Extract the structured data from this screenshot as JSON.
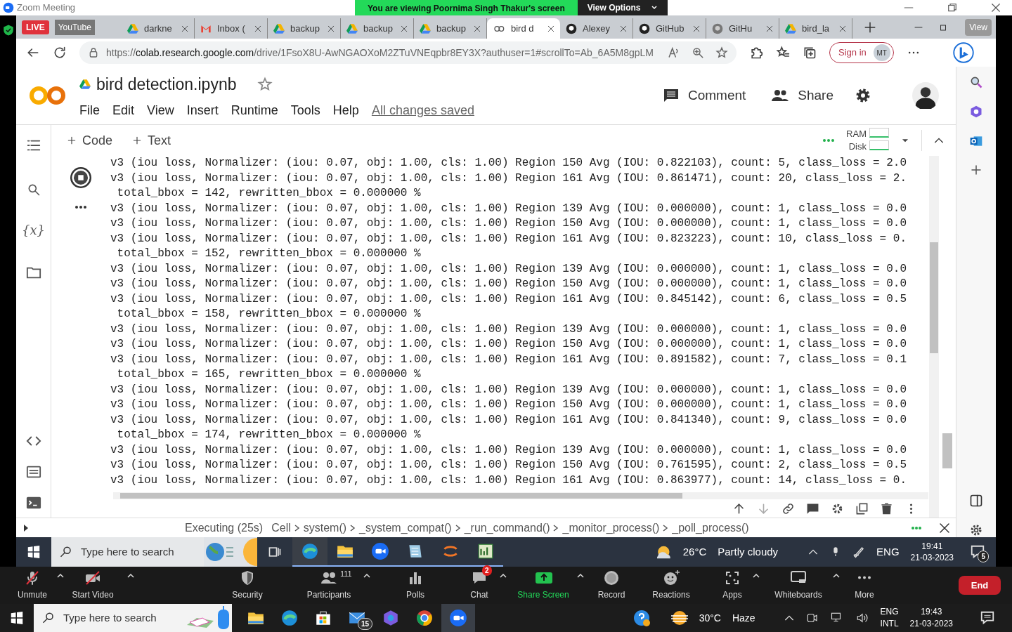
{
  "zoom_window": {
    "title": "Zoom Meeting",
    "banner": "You are viewing Poornima Singh Thakur's screen",
    "view_options": "View Options"
  },
  "stream_overlay": {
    "live": "LIVE",
    "platform": "YouTube",
    "view": "View"
  },
  "browser": {
    "tabs": [
      {
        "label": "darkne",
        "kind": "drive",
        "selected": false
      },
      {
        "label": "Inbox (",
        "kind": "gmail",
        "selected": false
      },
      {
        "label": "backup",
        "kind": "drive",
        "selected": false
      },
      {
        "label": "backup",
        "kind": "drive",
        "selected": false
      },
      {
        "label": "backup",
        "kind": "drive",
        "selected": false
      },
      {
        "label": "bird d",
        "kind": "colab",
        "selected": true
      },
      {
        "label": "Alexey",
        "kind": "github",
        "selected": false
      },
      {
        "label": "GitHub",
        "kind": "github",
        "selected": false
      },
      {
        "label": "GitHu",
        "kind": "github-grey",
        "selected": false
      },
      {
        "label": "bird_la",
        "kind": "drive",
        "selected": false
      }
    ],
    "url": {
      "scheme": "https://",
      "host": "colab.research.google.com",
      "path": "/drive/1FsoX8U-AwNGAOXoM2ZTuVNEqpbr8EY3X?authuser=1#scrollTo=Ab_6A5M8gpLM"
    },
    "sign_in": "Sign in",
    "profile": "MT"
  },
  "colab": {
    "title": "bird detection.ipynb",
    "menu": [
      "File",
      "Edit",
      "View",
      "Insert",
      "Runtime",
      "Tools",
      "Help"
    ],
    "saved": "All changes saved",
    "comment": "Comment",
    "share": "Share",
    "add_buttons": [
      "Code",
      "Text"
    ],
    "ram": "RAM",
    "disk": "Disk",
    "variables": "{x}",
    "output": [
      "v3 (iou loss, Normalizer: (iou: 0.07, obj: 1.00, cls: 1.00) Region 150 Avg (IOU: 0.822103), count: 5, class_loss = 2.0",
      "v3 (iou loss, Normalizer: (iou: 0.07, obj: 1.00, cls: 1.00) Region 161 Avg (IOU: 0.861471), count: 20, class_loss = 2.",
      " total_bbox = 142, rewritten_bbox = 0.000000 %",
      "v3 (iou loss, Normalizer: (iou: 0.07, obj: 1.00, cls: 1.00) Region 139 Avg (IOU: 0.000000), count: 1, class_loss = 0.0",
      "v3 (iou loss, Normalizer: (iou: 0.07, obj: 1.00, cls: 1.00) Region 150 Avg (IOU: 0.000000), count: 1, class_loss = 0.0",
      "v3 (iou loss, Normalizer: (iou: 0.07, obj: 1.00, cls: 1.00) Region 161 Avg (IOU: 0.823223), count: 10, class_loss = 0.",
      " total_bbox = 152, rewritten_bbox = 0.000000 %",
      "v3 (iou loss, Normalizer: (iou: 0.07, obj: 1.00, cls: 1.00) Region 139 Avg (IOU: 0.000000), count: 1, class_loss = 0.0",
      "v3 (iou loss, Normalizer: (iou: 0.07, obj: 1.00, cls: 1.00) Region 150 Avg (IOU: 0.000000), count: 1, class_loss = 0.0",
      "v3 (iou loss, Normalizer: (iou: 0.07, obj: 1.00, cls: 1.00) Region 161 Avg (IOU: 0.845142), count: 6, class_loss = 0.5",
      " total_bbox = 158, rewritten_bbox = 0.000000 %",
      "v3 (iou loss, Normalizer: (iou: 0.07, obj: 1.00, cls: 1.00) Region 139 Avg (IOU: 0.000000), count: 1, class_loss = 0.0",
      "v3 (iou loss, Normalizer: (iou: 0.07, obj: 1.00, cls: 1.00) Region 150 Avg (IOU: 0.000000), count: 1, class_loss = 0.0",
      "v3 (iou loss, Normalizer: (iou: 0.07, obj: 1.00, cls: 1.00) Region 161 Avg (IOU: 0.891582), count: 7, class_loss = 0.1",
      " total_bbox = 165, rewritten_bbox = 0.000000 %",
      "v3 (iou loss, Normalizer: (iou: 0.07, obj: 1.00, cls: 1.00) Region 139 Avg (IOU: 0.000000), count: 1, class_loss = 0.0",
      "v3 (iou loss, Normalizer: (iou: 0.07, obj: 1.00, cls: 1.00) Region 150 Avg (IOU: 0.000000), count: 1, class_loss = 0.0",
      "v3 (iou loss, Normalizer: (iou: 0.07, obj: 1.00, cls: 1.00) Region 161 Avg (IOU: 0.841340), count: 9, class_loss = 0.0",
      " total_bbox = 174, rewritten_bbox = 0.000000 %",
      "v3 (iou loss, Normalizer: (iou: 0.07, obj: 1.00, cls: 1.00) Region 139 Avg (IOU: 0.000000), count: 1, class_loss = 0.0",
      "v3 (iou loss, Normalizer: (iou: 0.07, obj: 1.00, cls: 1.00) Region 150 Avg (IOU: 0.761595), count: 2, class_loss = 0.5",
      "v3 (iou loss, Normalizer: (iou: 0.07, obj: 1.00, cls: 1.00) Region 161 Avg (IOU: 0.863977), count: 14, class_loss = 0."
    ],
    "status": {
      "state": "Executing (25s)",
      "trace": [
        "Cell",
        "system()",
        "_system_compat()",
        "_run_command()",
        "_monitor_process()",
        "_poll_process()"
      ]
    }
  },
  "inner_taskbar": {
    "search": "Type here to search",
    "apps": [
      {
        "kind": "edge",
        "active": true
      },
      {
        "kind": "folder",
        "active": false
      },
      {
        "kind": "zoom",
        "active": false
      },
      {
        "kind": "notepad",
        "active": false
      },
      {
        "kind": "jupyter",
        "active": false
      },
      {
        "kind": "sheet",
        "active": false
      }
    ],
    "temperature": "26°C",
    "weather": "Partly cloudy",
    "language": "ENG",
    "time": "19:41",
    "date": "21-03-2023",
    "notifications": "5"
  },
  "zoom_controls": [
    {
      "label": "Unmute",
      "kind": "mic-off",
      "caret": true
    },
    {
      "label": "Start Video",
      "kind": "video-off",
      "caret": true
    },
    {
      "label": "Security",
      "kind": "shield",
      "caret": false
    },
    {
      "label": "Participants",
      "kind": "people",
      "caret": true,
      "count": "111"
    },
    {
      "label": "Polls",
      "kind": "polls",
      "caret": false
    },
    {
      "label": "Chat",
      "kind": "chat",
      "caret": true,
      "badge": "2"
    },
    {
      "label": "Share Screen",
      "kind": "share",
      "caret": true
    },
    {
      "label": "Record",
      "kind": "record",
      "caret": false
    },
    {
      "label": "Reactions",
      "kind": "reactions",
      "caret": false
    },
    {
      "label": "Apps",
      "kind": "apps",
      "caret": true
    },
    {
      "label": "Whiteboards",
      "kind": "whiteboard",
      "caret": true
    },
    {
      "label": "More",
      "kind": "more",
      "caret": false
    }
  ],
  "end_button": "End",
  "taskbar": {
    "search": "Type here to search",
    "apps": [
      {
        "kind": "folder",
        "active": false
      },
      {
        "kind": "edge",
        "active": false
      },
      {
        "kind": "store",
        "active": false
      },
      {
        "kind": "mail",
        "active": false,
        "badge": "15"
      },
      {
        "kind": "copilot",
        "active": false
      },
      {
        "kind": "chrome",
        "active": false
      },
      {
        "kind": "zoom",
        "active": true
      }
    ],
    "temperature": "30°C",
    "weather": "Haze",
    "language": "ENG",
    "layout": "INTL",
    "time": "19:43",
    "date": "21-03-2023"
  }
}
